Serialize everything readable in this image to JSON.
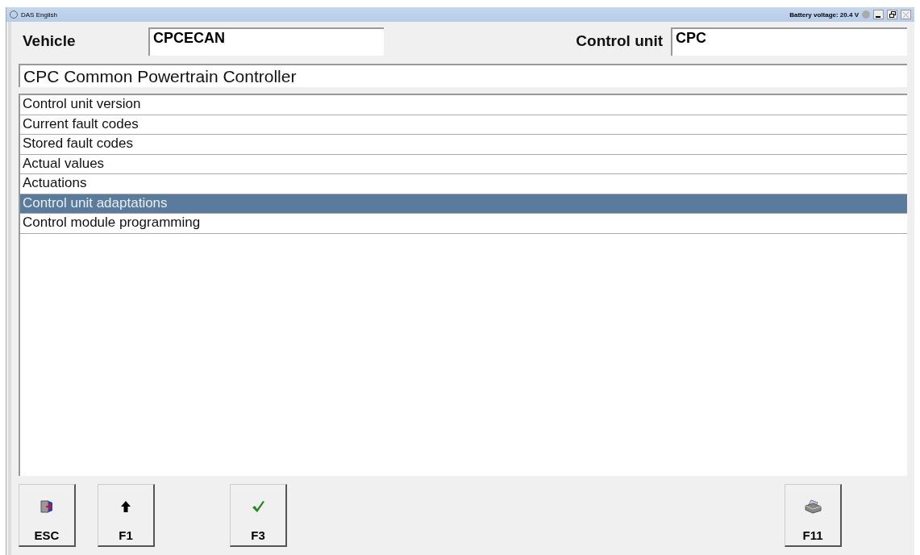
{
  "window": {
    "title": "DAS English",
    "battery": "Battery voltage: 20.4 V"
  },
  "header": {
    "vehicle_label": "Vehicle",
    "vehicle_value": "CPCECAN",
    "control_unit_label": "Control unit",
    "control_unit_value": "CPC"
  },
  "title": "CPC Common Powertrain Controller",
  "menu": [
    {
      "label": "Control unit version",
      "selected": false
    },
    {
      "label": "Current fault codes",
      "selected": false
    },
    {
      "label": "Stored fault codes",
      "selected": false
    },
    {
      "label": "Actual values",
      "selected": false
    },
    {
      "label": "Actuations",
      "selected": false
    },
    {
      "label": "Control unit adaptations",
      "selected": true
    },
    {
      "label": "Control module programming",
      "selected": false
    }
  ],
  "keys": [
    {
      "label": "ESC",
      "kind": "exit"
    },
    {
      "label": "F1",
      "kind": "up"
    },
    {
      "label": "F3",
      "kind": "ok"
    },
    {
      "label": "F11",
      "kind": "print"
    }
  ]
}
